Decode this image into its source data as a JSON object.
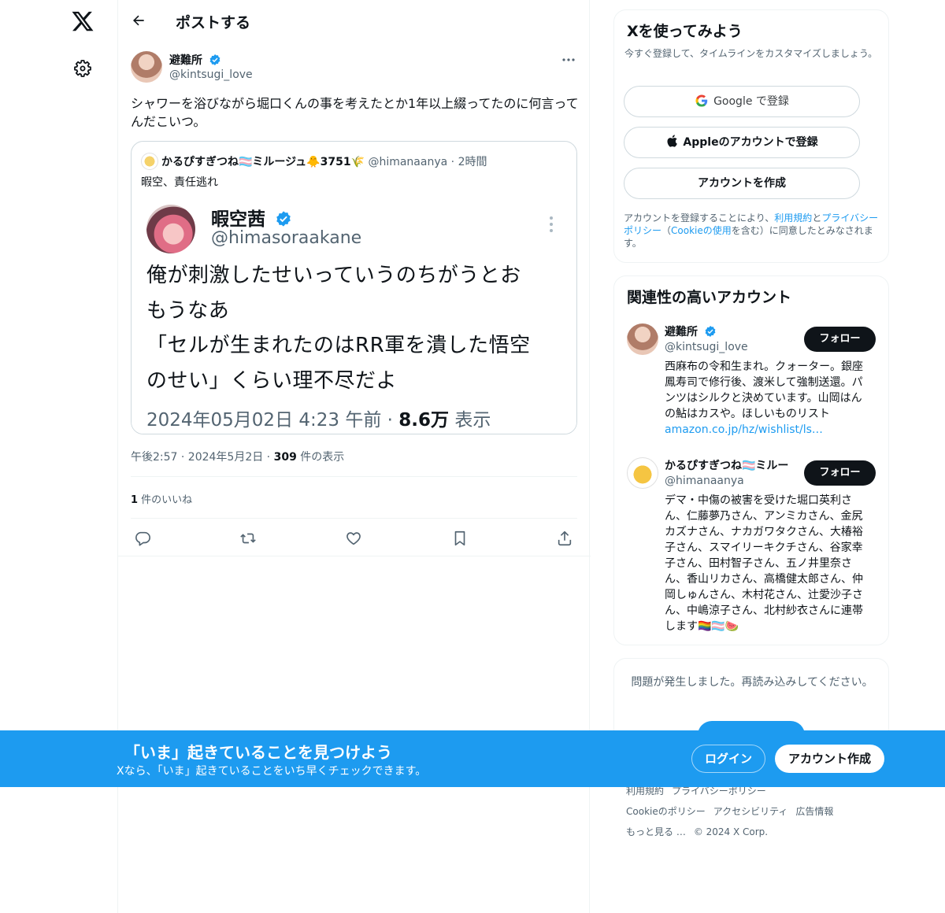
{
  "colors": {
    "accent": "#1d9bf0",
    "text": "#0f1419",
    "muted": "#536471",
    "border": "#eff3f4"
  },
  "nav": {
    "logo_icon": "x-logo-icon",
    "settings_icon": "gear-icon"
  },
  "header": {
    "title": "ポストする",
    "back_icon": "arrow-left-icon"
  },
  "post": {
    "author_name": "避難所",
    "author_handle": "@kintsugi_love",
    "text": "シャワーを浴びながら堀口くんの事を考えたとか1年以上綴ってたのに何言ってんだこいつ。",
    "quote": {
      "name": "かるぴすぎつね🏳️‍⚧️ミルージュ🐥3751🌾",
      "handle": "@himanaanya",
      "sep": "·",
      "age": "2時間",
      "text": "暇空、責任逃れ",
      "image": {
        "name": "暇空茜",
        "handle": "@himasoraakane",
        "lines": [
          "俺が刺激したせいっていうのちがうとお",
          "もうなあ",
          "「セルが生まれたのはRR軍を潰した悟空",
          "のせい」くらい理不尽だよ"
        ],
        "date": "2024年05月02日 4:23 午前 · ",
        "views": "8.6万",
        "views_label": " 表示"
      }
    },
    "time": "午後2:57 · 2024年5月2日 · ",
    "views": "309",
    "views_label": " 件の表示",
    "likes": "1",
    "likes_label": " 件のいいね",
    "actions": [
      "reply-icon",
      "retweet-icon",
      "like-icon",
      "bookmark-icon",
      "share-icon"
    ]
  },
  "signup": {
    "title": "Xを使ってみよう",
    "subtitle": "今すぐ登録して、タイムラインをカスタマイズしましょう。",
    "google_label": "Google で登録",
    "apple_label": "Appleのアカウントで登録",
    "create_label": "アカウントを作成",
    "legal_1": "アカウントを登録することにより、",
    "legal_terms": "利用規約",
    "legal_2": "と",
    "legal_privacy": "プライバシーポリシー",
    "legal_3": "（",
    "legal_cookie": "Cookieの使用",
    "legal_4": "を含む）に同意したとみなされます。"
  },
  "related": {
    "title": "関連性の高いアカウント",
    "accounts": [
      {
        "name": "避難所",
        "handle": "@kintsugi_love",
        "bio": "西麻布の令和生まれ。クォーター。銀座鳳寿司で修行後、渡米して強制送還。パンツはシルクと決めています。山岡はんの鮎はカスや。ほしいものリスト",
        "bio_link": "amazon.co.jp/hz/wishlist/ls…",
        "follow": "フォロー"
      },
      {
        "name": "かるぴすぎつね🏳️‍⚧️ミルー",
        "handle": "@himanaanya",
        "bio": "デマ・中傷の被害を受けた堀口英利さん、仁藤夢乃さん、アンミカさん、金尻カズナさん、ナカガワタクさん、大椿裕子さん、スマイリーキクチさん、谷家幸子さん、田村智子さん、五ノ井里奈さん、香山リカさん、高橋健太郎さん、仲岡しゅんさん、木村花さん、辻愛沙子さん、中嶋涼子さん、北村紗衣さんに連帯します🏳️‍🌈🏳️‍⚧️🍉",
        "follow": "フォロー"
      }
    ]
  },
  "error": {
    "text": "問題が発生しました。再読み込みしてください。"
  },
  "footer": {
    "links": [
      "利用規約",
      "プライバシーポリシー",
      "Cookieのポリシー",
      "アクセシビリティ",
      "広告情報",
      "もっと見る …",
      "© 2024 X Corp."
    ]
  },
  "banner": {
    "title": "「いま」起きていることを見つけよう",
    "subtitle": "Xなら、「いま」起きていることをいち早くチェックできます。",
    "login": "ログイン",
    "signup": "アカウント作成"
  }
}
